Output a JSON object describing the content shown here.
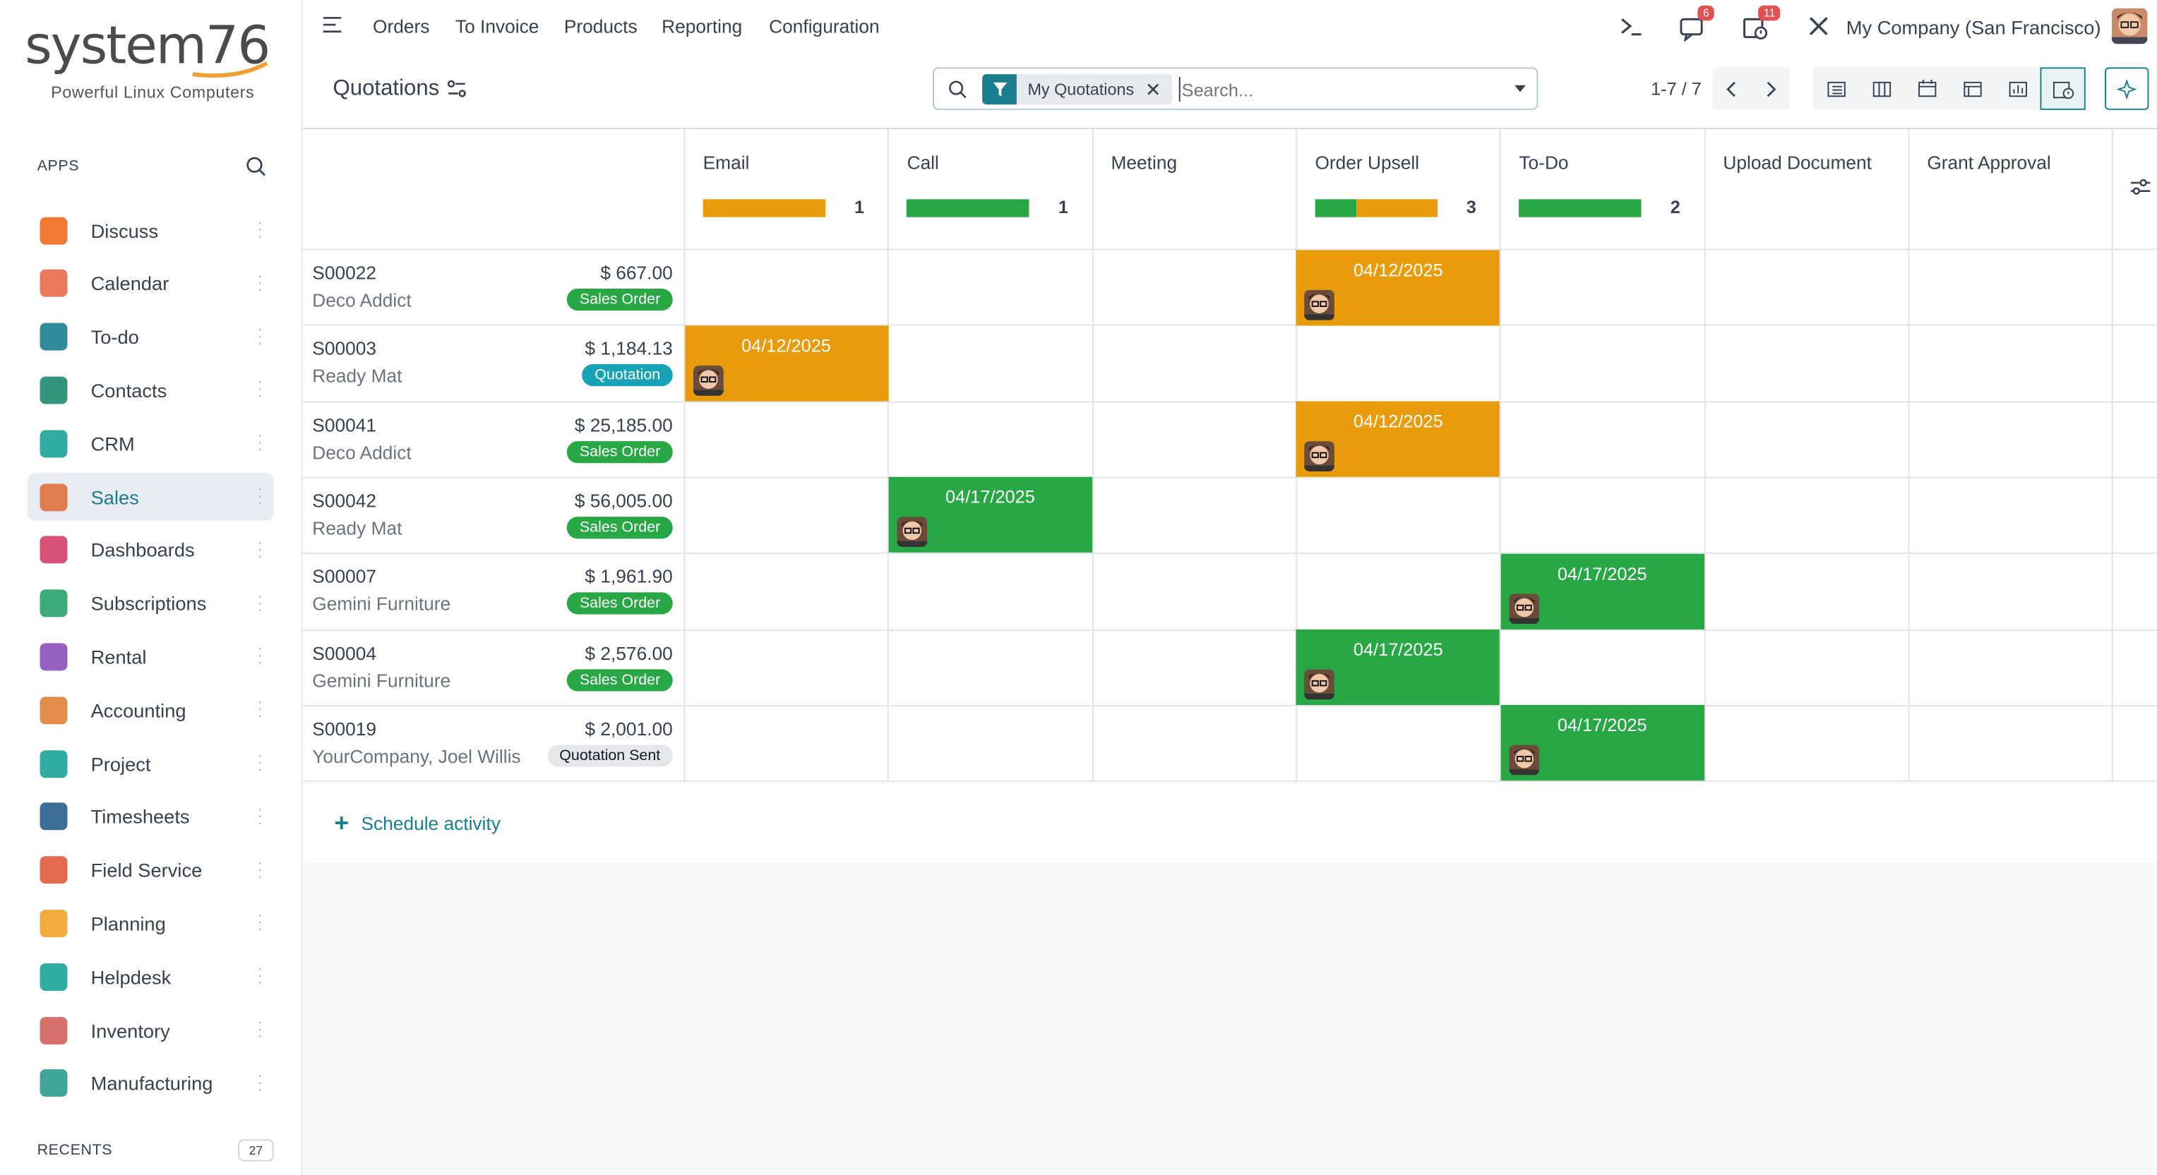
{
  "brand": {
    "wordmark": "system76",
    "tagline": "Powerful Linux Computers"
  },
  "sidebar": {
    "apps_header": "APPS",
    "items": [
      {
        "label": "Discuss",
        "icon": "discuss-icon",
        "color": "#f06a1d"
      },
      {
        "label": "Calendar",
        "icon": "calendar-icon",
        "color": "#e96b4b"
      },
      {
        "label": "To-do",
        "icon": "todo-icon",
        "color": "#1a7e8f"
      },
      {
        "label": "Contacts",
        "icon": "contacts-icon",
        "color": "#1e8a6e"
      },
      {
        "label": "CRM",
        "icon": "crm-icon",
        "color": "#1ba397"
      },
      {
        "label": "Sales",
        "icon": "sales-icon",
        "color": "#e06f3c"
      },
      {
        "label": "Dashboards",
        "icon": "dashboards-icon",
        "color": "#d33f6a"
      },
      {
        "label": "Subscriptions",
        "icon": "subscriptions-icon",
        "color": "#29a36a"
      },
      {
        "label": "Rental",
        "icon": "rental-icon",
        "color": "#8d4fbd"
      },
      {
        "label": "Accounting",
        "icon": "accounting-icon",
        "color": "#e0813a"
      },
      {
        "label": "Project",
        "icon": "project-icon",
        "color": "#1ba397"
      },
      {
        "label": "Timesheets",
        "icon": "timesheets-icon",
        "color": "#2a5d8f"
      },
      {
        "label": "Field Service",
        "icon": "field-service-icon",
        "color": "#e05b3a"
      },
      {
        "label": "Planning",
        "icon": "planning-icon",
        "color": "#f1a22a"
      },
      {
        "label": "Helpdesk",
        "icon": "helpdesk-icon",
        "color": "#1ba397"
      },
      {
        "label": "Inventory",
        "icon": "inventory-icon",
        "color": "#d2615b"
      },
      {
        "label": "Manufacturing",
        "icon": "manufacturing-icon",
        "color": "#2a9d8f"
      }
    ],
    "active": "Sales",
    "recents_label": "RECENTS",
    "recents_count": "27"
  },
  "topnav": {
    "menus": [
      "Orders",
      "To Invoice",
      "Products",
      "Reporting",
      "Configuration"
    ],
    "messages_badge": "6",
    "activities_badge": "11",
    "company": "My Company (San Francisco)"
  },
  "control_panel": {
    "title": "Quotations",
    "facet": "My Quotations",
    "search_placeholder": "Search...",
    "pager": "1-7 / 7"
  },
  "activity_view": {
    "columns": [
      {
        "label": "Email",
        "count": "1",
        "bar": [
          {
            "color": "#e89c0b",
            "share": 1
          }
        ]
      },
      {
        "label": "Call",
        "count": "1",
        "bar": [
          {
            "color": "#28a745",
            "share": 1
          }
        ]
      },
      {
        "label": "Meeting",
        "count": "",
        "bar": []
      },
      {
        "label": "Order Upsell",
        "count": "3",
        "bar": [
          {
            "color": "#28a745",
            "share": 0.333
          },
          {
            "color": "#e89c0b",
            "share": 0.667
          }
        ]
      },
      {
        "label": "To-Do",
        "count": "2",
        "bar": [
          {
            "color": "#28a745",
            "share": 1
          }
        ]
      },
      {
        "label": "Upload Document",
        "count": "",
        "bar": []
      },
      {
        "label": "Grant Approval",
        "count": "",
        "bar": []
      }
    ],
    "rows": [
      {
        "name": "S00022",
        "partner": "Deco Addict",
        "amount": "$ 667.00",
        "status": "Sales Order",
        "status_color": "#28a745",
        "cells": [
          {
            "col": 3,
            "date": "04/12/2025",
            "color": "#e89c0b"
          }
        ]
      },
      {
        "name": "S00003",
        "partner": "Ready Mat",
        "amount": "$ 1,184.13",
        "status": "Quotation",
        "status_color": "#17a2b8",
        "cells": [
          {
            "col": 0,
            "date": "04/12/2025",
            "color": "#e89c0b"
          }
        ]
      },
      {
        "name": "S00041",
        "partner": "Deco Addict",
        "amount": "$ 25,185.00",
        "status": "Sales Order",
        "status_color": "#28a745",
        "cells": [
          {
            "col": 3,
            "date": "04/12/2025",
            "color": "#e89c0b"
          }
        ]
      },
      {
        "name": "S00042",
        "partner": "Ready Mat",
        "amount": "$ 56,005.00",
        "status": "Sales Order",
        "status_color": "#28a745",
        "cells": [
          {
            "col": 1,
            "date": "04/17/2025",
            "color": "#28a745"
          }
        ]
      },
      {
        "name": "S00007",
        "partner": "Gemini Furniture",
        "amount": "$ 1,961.90",
        "status": "Sales Order",
        "status_color": "#28a745",
        "cells": [
          {
            "col": 4,
            "date": "04/17/2025",
            "color": "#28a745"
          }
        ]
      },
      {
        "name": "S00004",
        "partner": "Gemini Furniture",
        "amount": "$ 2,576.00",
        "status": "Sales Order",
        "status_color": "#28a745",
        "cells": [
          {
            "col": 3,
            "date": "04/17/2025",
            "color": "#28a745"
          }
        ]
      },
      {
        "name": "S00019",
        "partner": "YourCompany, Joel Willis",
        "amount": "$ 2,001.00",
        "status": "Quotation Sent",
        "status_color": "#e5e7eb",
        "cells": [
          {
            "col": 4,
            "date": "04/17/2025",
            "color": "#28a745"
          }
        ]
      }
    ],
    "schedule_label": "Schedule activity"
  }
}
